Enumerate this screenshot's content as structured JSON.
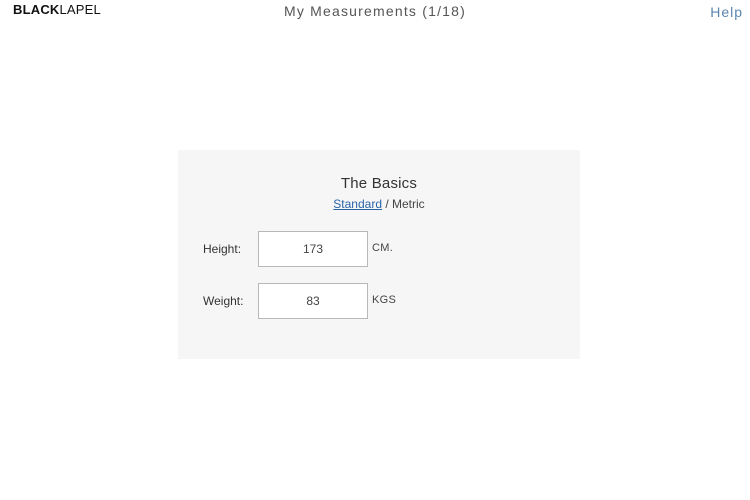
{
  "header": {
    "logo_bold": "BLACK",
    "logo_light": "LAPEL",
    "title": "My Measurements (1/18)",
    "help_label": "Help"
  },
  "card": {
    "title": "The Basics",
    "units": {
      "standard_label": "Standard",
      "separator": " / ",
      "metric_label": "Metric"
    },
    "fields": [
      {
        "label": "Height:",
        "value": "173",
        "unit": "CM."
      },
      {
        "label": "Weight:",
        "value": "83",
        "unit": "KGS"
      }
    ]
  },
  "colors": {
    "link": "#2a63a8",
    "help": "#5b86b0",
    "card_background": "#f6f6f6"
  }
}
